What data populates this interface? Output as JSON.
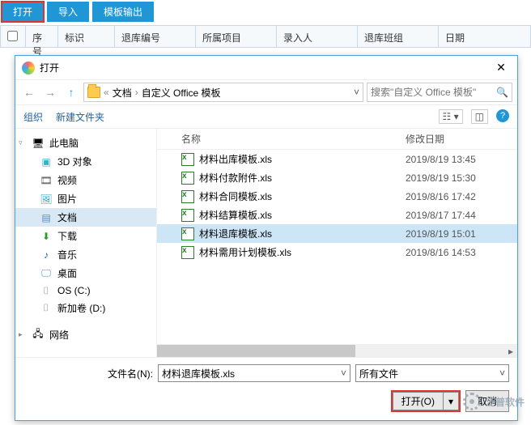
{
  "toolbar": {
    "open": "打开",
    "import": "导入",
    "template_output": "模板输出"
  },
  "grid": {
    "chk": "",
    "seq": "序号",
    "bs": "标识",
    "bh": "退库编号",
    "xm": "所属项目",
    "lr": "录入人",
    "bz": "退库班组",
    "rq": "日期"
  },
  "dialog": {
    "title": "打开",
    "crumb": {
      "p1": "文档",
      "p2": "自定义 Office 模板"
    },
    "search_placeholder": "搜索\"自定义 Office 模板\"",
    "org": "组织",
    "newfolder": "新建文件夹",
    "col_name": "名称",
    "col_date": "修改日期",
    "filename_label": "文件名(N):",
    "filename_value": "材料退库模板.xls",
    "filter": "所有文件",
    "btn_open": "打开(O)",
    "btn_cancel": "取消"
  },
  "tree": {
    "pc": "此电脑",
    "obj3d": "3D 对象",
    "video": "视频",
    "pic": "图片",
    "doc": "文档",
    "dl": "下载",
    "music": "音乐",
    "desk": "桌面",
    "osc": "OS (C:)",
    "dd": "新加卷 (D:)",
    "net": "网络"
  },
  "files": [
    {
      "name": "材料出库模板.xls",
      "date": "2019/8/19 13:45",
      "selected": false
    },
    {
      "name": "材料付款附件.xls",
      "date": "2019/8/19 15:30",
      "selected": false
    },
    {
      "name": "材料合同模板.xls",
      "date": "2019/8/16 17:42",
      "selected": false
    },
    {
      "name": "材料结算模板.xls",
      "date": "2019/8/17 17:44",
      "selected": false
    },
    {
      "name": "材料退库模板.xls",
      "date": "2019/8/19 15:01",
      "selected": true
    },
    {
      "name": "材料需用计划模板.xls",
      "date": "2019/8/16 14:53",
      "selected": false
    }
  ],
  "watermark": "泛普软件"
}
